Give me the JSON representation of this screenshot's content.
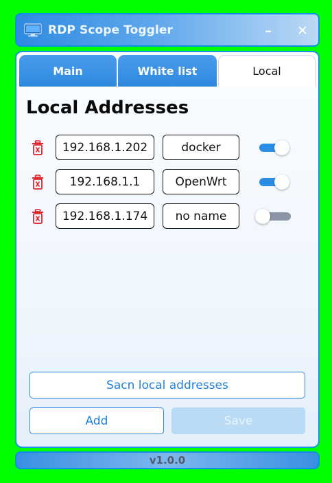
{
  "window": {
    "title": "RDP Scope Toggler",
    "icon": "monitor-icon",
    "minimize_glyph": "–",
    "close_glyph": "✕"
  },
  "tabs": [
    {
      "label": "Main",
      "active": false
    },
    {
      "label": "White list",
      "active": false
    },
    {
      "label": "Local",
      "active": true
    }
  ],
  "main": {
    "heading": "Local Addresses",
    "rows": [
      {
        "ip": "192.168.1.202",
        "name": "docker",
        "enabled": true
      },
      {
        "ip": "192.168.1.1",
        "name": "OpenWrt",
        "enabled": true
      },
      {
        "ip": "192.168.1.174",
        "name": "no name",
        "enabled": false
      }
    ],
    "scan_label": "Sacn local addresses",
    "add_label": "Add",
    "save_label": "Save",
    "save_disabled": true
  },
  "footer": {
    "version": "v1.0.0"
  },
  "colors": {
    "background": "#00ff00",
    "accent": "#2b8ce6",
    "delete": "#e0252b",
    "toggle_off": "#8a96a8"
  }
}
